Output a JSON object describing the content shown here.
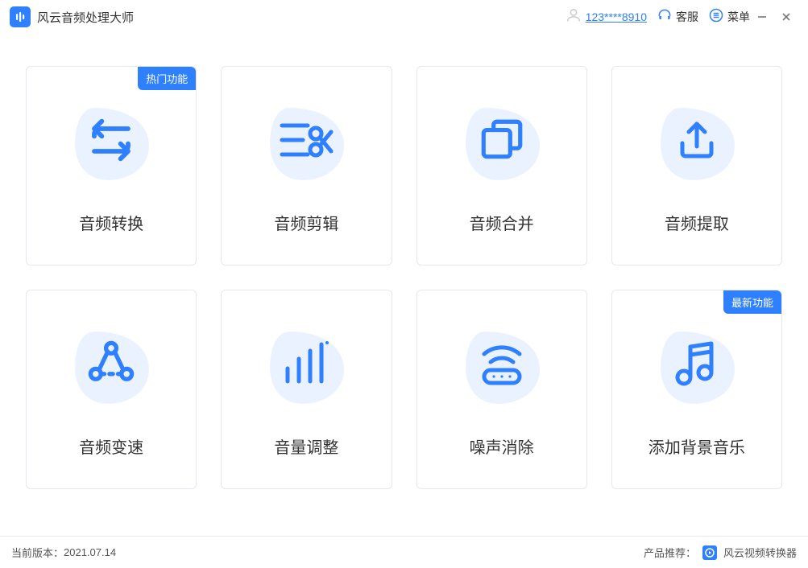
{
  "app": {
    "title": "风云音频处理大师"
  },
  "header": {
    "user_label": "123****8910",
    "service_label": "客服",
    "menu_label": "菜单"
  },
  "ribbons": {
    "hot": "热门功能",
    "new": "最新功能"
  },
  "cards": [
    {
      "title": "音频转换"
    },
    {
      "title": "音频剪辑"
    },
    {
      "title": "音频合并"
    },
    {
      "title": "音频提取"
    },
    {
      "title": "音频变速"
    },
    {
      "title": "音量调整"
    },
    {
      "title": "噪声消除"
    },
    {
      "title": "添加背景音乐"
    }
  ],
  "footer": {
    "version_label": "当前版本：",
    "version_value": "2021.07.14",
    "recommend_label": "产品推荐：",
    "recommend_product": "风云视频转换器"
  },
  "colors": {
    "primary": "#2F80FF",
    "blob": "#EAF2FF"
  }
}
